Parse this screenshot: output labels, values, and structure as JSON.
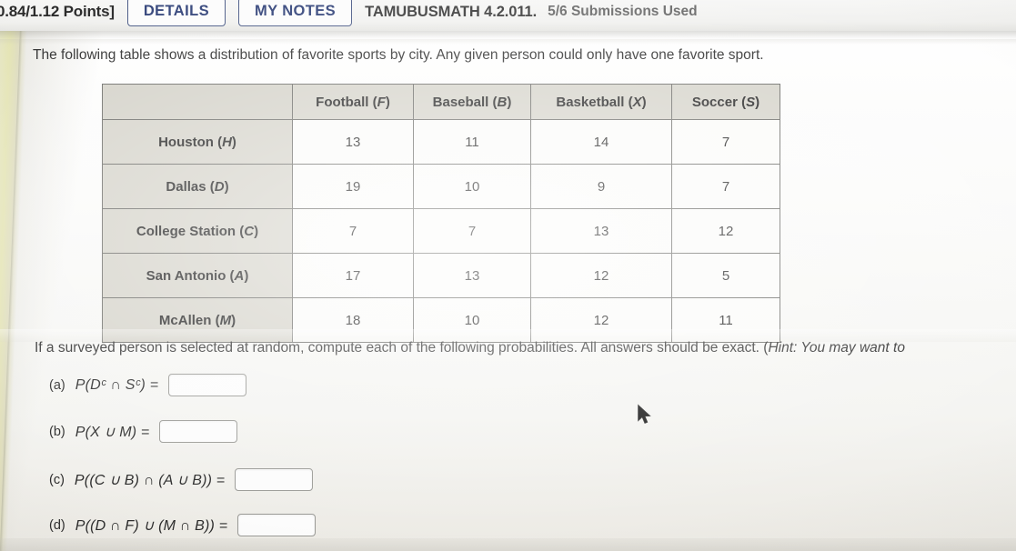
{
  "header": {
    "points": "0.84/1.12 Points]",
    "details_label": "DETAILS",
    "my_notes_label": "MY NOTES",
    "assignment_id": "TAMUBUSMATH 4.2.011.",
    "submissions": "5/6 Submissions Used"
  },
  "intro": "The following table shows a distribution of favorite sports by city. Any given person could only have one favorite sport.",
  "table": {
    "corner": "",
    "columns": [
      {
        "label": "Football",
        "symbol": "F"
      },
      {
        "label": "Baseball",
        "symbol": "B"
      },
      {
        "label": "Basketball",
        "symbol": "X"
      },
      {
        "label": "Soccer",
        "symbol": "S"
      }
    ],
    "rows": [
      {
        "city": "Houston",
        "symbol": "H",
        "values": [
          13,
          11,
          14,
          7
        ]
      },
      {
        "city": "Dallas",
        "symbol": "D",
        "values": [
          19,
          10,
          9,
          7
        ]
      },
      {
        "city": "College Station",
        "symbol": "C",
        "values": [
          7,
          7,
          13,
          12
        ]
      },
      {
        "city": "San Antonio",
        "symbol": "A",
        "values": [
          17,
          13,
          12,
          5
        ]
      },
      {
        "city": "McAllen",
        "symbol": "M",
        "values": [
          18,
          10,
          12,
          11
        ]
      }
    ]
  },
  "prompt": {
    "text": "If a surveyed person is selected at random, compute each of the following probabilities. All answers should be exact. (",
    "hint_word": "Hint:",
    "hint_rest": " You may want to"
  },
  "questions": [
    {
      "label": "(a)",
      "expression": "P(Dᶜ ∩ Sᶜ) =",
      "answer": "",
      "placeholder": ""
    },
    {
      "label": "(b)",
      "expression": "P(X ∪ M) =",
      "answer": "",
      "placeholder": ""
    },
    {
      "label": "(c)",
      "expression": "P((C ∪ B) ∩ (A ∪ B)) =",
      "answer": "",
      "placeholder": ""
    },
    {
      "label": "(d)",
      "expression": "P((D ∩ F) ∪ (M ∩ B)) =",
      "answer": "",
      "placeholder": ""
    }
  ],
  "colors": {
    "tab_border": "#4a5a86",
    "tab_text": "#33447a",
    "table_header_bg": "#d6d4cb",
    "table_cell_bg": "#fbfbf9",
    "left_strip": "#e4e4b4"
  }
}
